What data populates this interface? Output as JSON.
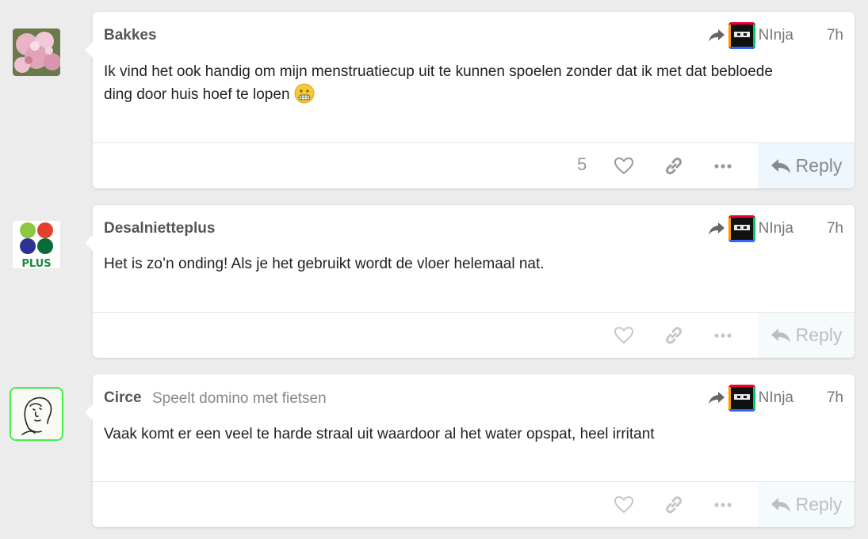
{
  "posts": [
    {
      "username": "Bakkes",
      "user_title": "",
      "reply_to": "NInja",
      "time": "7h",
      "text_line1": "Ik vind het ook handig om mijn menstruatiecup uit te kunnen spoelen zonder dat ik met dat bebloede",
      "text_line2": "ding door huis hoef te lopen",
      "emoji": "grimacing-face",
      "like_count": "5",
      "reply_label": "Reply"
    },
    {
      "username": "Desalnietteplus",
      "user_title": "",
      "reply_to": "NInja",
      "time": "7h",
      "text_line1": "Het is zo’n onding! Als je het gebruikt wordt de vloer helemaal nat.",
      "reply_label": "Reply",
      "avatar_logo_text": "PLUS"
    },
    {
      "username": "Circe",
      "user_title": "Speelt domino met fietsen",
      "reply_to": "NInja",
      "time": "7h",
      "text_line1": "Vaak komt er een veel te harde straal uit waardoor al het water opspat, heel irritant",
      "reply_label": "Reply"
    }
  ],
  "icons": {
    "reply_arrow": "share-arrow-icon",
    "like": "heart-icon",
    "link": "link-icon",
    "more": "ellipsis-icon",
    "reply": "reply-icon"
  },
  "colors": {
    "background": "#ececec",
    "card": "#ffffff",
    "reply_bg": "#eef7fd",
    "muted": "#999999",
    "circe_avatar_border": "#44ee44"
  }
}
